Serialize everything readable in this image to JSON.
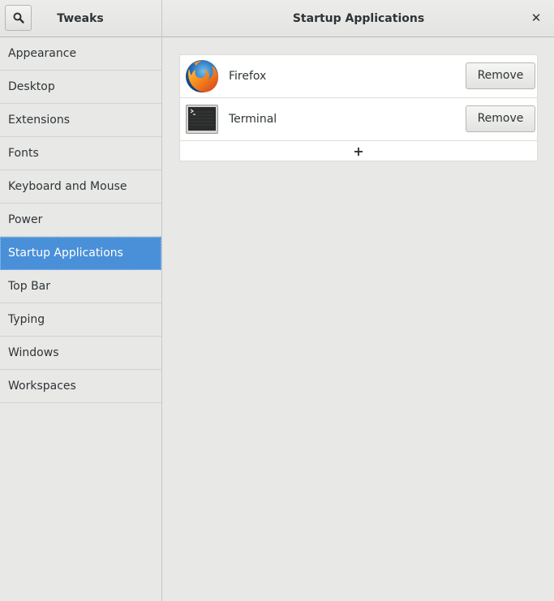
{
  "window": {
    "sidebar_title": "Tweaks",
    "panel_title": "Startup Applications"
  },
  "header": {
    "search_icon": "search-icon",
    "close_icon": "close-icon",
    "close_glyph": "✕"
  },
  "sidebar": {
    "items": [
      {
        "label": "Appearance",
        "selected": false
      },
      {
        "label": "Desktop",
        "selected": false
      },
      {
        "label": "Extensions",
        "selected": false
      },
      {
        "label": "Fonts",
        "selected": false
      },
      {
        "label": "Keyboard and Mouse",
        "selected": false
      },
      {
        "label": "Power",
        "selected": false
      },
      {
        "label": "Startup Applications",
        "selected": true
      },
      {
        "label": "Top Bar",
        "selected": false
      },
      {
        "label": "Typing",
        "selected": false
      },
      {
        "label": "Windows",
        "selected": false
      },
      {
        "label": "Workspaces",
        "selected": false
      }
    ]
  },
  "startup_apps": {
    "apps": [
      {
        "name": "Firefox",
        "icon": "firefox-icon",
        "remove_label": "Remove"
      },
      {
        "name": "Terminal",
        "icon": "terminal-icon",
        "remove_label": "Remove"
      }
    ],
    "add_glyph": "+"
  },
  "colors": {
    "accent": "#4a90d9",
    "background": "#e8e8e7"
  }
}
